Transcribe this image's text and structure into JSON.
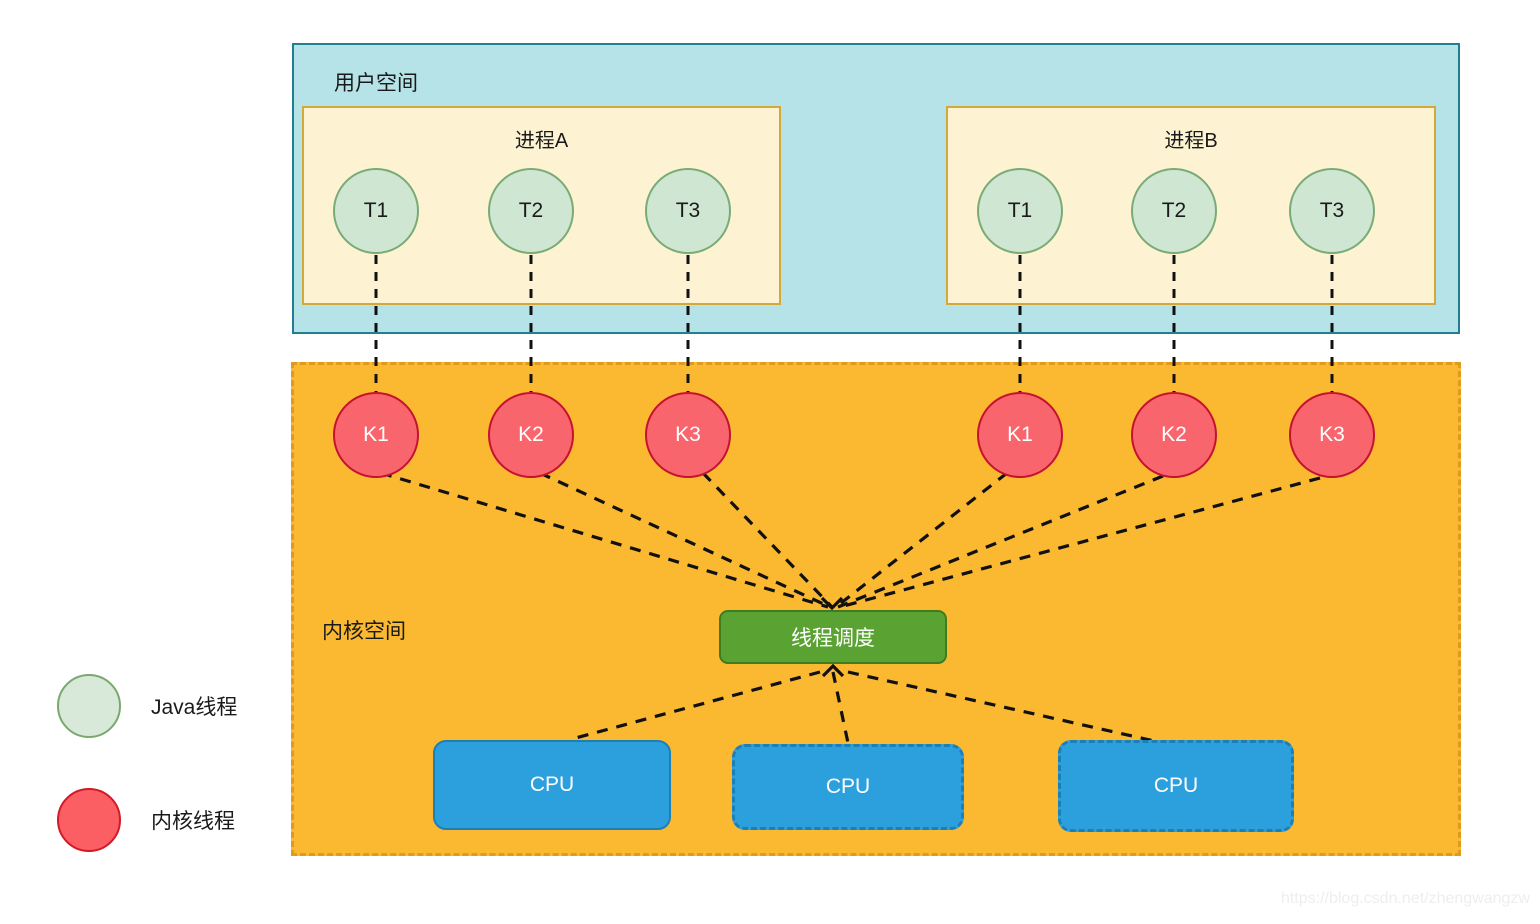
{
  "diagram": {
    "watermark": "https://blog.csdn.net/zhengwangzw"
  },
  "user_space": {
    "label": "用户空间",
    "processes": [
      {
        "title": "进程A",
        "threads": [
          {
            "label": "T1"
          },
          {
            "label": "T2"
          },
          {
            "label": "T3"
          }
        ]
      },
      {
        "title": "进程B",
        "threads": [
          {
            "label": "T1"
          },
          {
            "label": "T2"
          },
          {
            "label": "T3"
          }
        ]
      }
    ]
  },
  "kernel_space": {
    "label": "内核空间",
    "kernel_threads": [
      {
        "label": "K1"
      },
      {
        "label": "K2"
      },
      {
        "label": "K3"
      },
      {
        "label": "K1"
      },
      {
        "label": "K2"
      },
      {
        "label": "K3"
      }
    ],
    "scheduler": {
      "label": "线程调度"
    },
    "cpus": [
      {
        "label": "CPU",
        "border": "solid"
      },
      {
        "label": "CPU",
        "border": "dashed"
      },
      {
        "label": "CPU",
        "border": "dashed"
      }
    ]
  },
  "legend": {
    "items": [
      {
        "label": "Java线程",
        "color": "#d9e9d9"
      },
      {
        "label": "内核线程",
        "color": "#fb5e63"
      }
    ]
  },
  "colors": {
    "user_space_fill": "#b5e3e7",
    "user_space_border": "#20808f",
    "process_fill": "#fdf3d2",
    "process_border": "#d4a93c",
    "java_thread_fill": "#cfe6d2",
    "java_thread_border": "#79ab77",
    "kernel_space_fill": "#fbb831",
    "kernel_space_border": "#e09a1f",
    "kernel_thread_fill": "#f9656d",
    "kernel_thread_border": "#c41230",
    "scheduler_fill": "#5aa332",
    "cpu_fill": "#2ba0dd",
    "link_color": "#111111"
  }
}
